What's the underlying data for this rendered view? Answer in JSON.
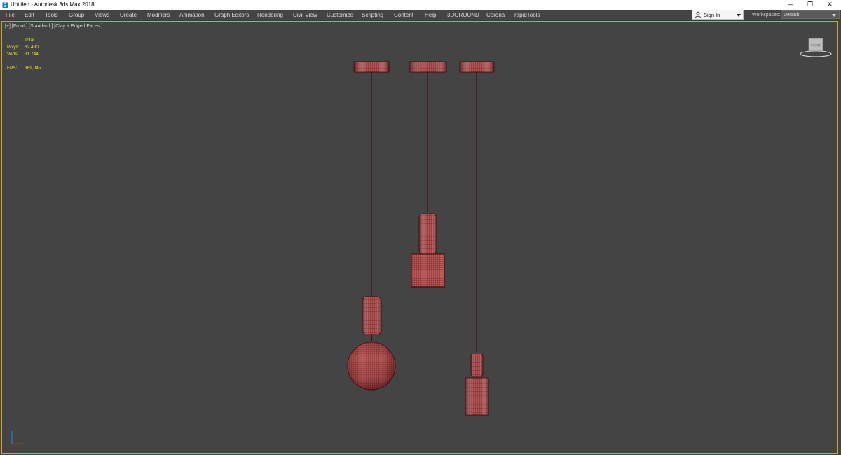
{
  "window": {
    "title": "Untitled - Autodesk 3ds Max 2018",
    "controls": {
      "minimize": "—",
      "restore": "❐",
      "close": "✕"
    }
  },
  "menu": {
    "items": [
      "File",
      "Edit",
      "Tools",
      "Group",
      "Views",
      "Create",
      "Modifiers",
      "Animation",
      "Graph Editors",
      "Rendering",
      "Civil View",
      "Customize",
      "Scripting",
      "Content",
      "Help",
      "3DGROUND",
      "Corona",
      "rapidTools"
    ]
  },
  "account": {
    "signin_label": "Sign In"
  },
  "workspaces": {
    "label": "Workspaces:",
    "value": "Default"
  },
  "viewport": {
    "label": "[+] [Front ] [Standard ] [Clay + Edged Faces ]",
    "stats": {
      "total_label": "Total",
      "polys_label": "Polys:",
      "polys_value": "62 480",
      "verts_label": "Verts:",
      "verts_value": "31 744",
      "fps_label": "FPS:",
      "fps_value": "389,045"
    },
    "viewcube_label": "FRONT"
  },
  "colors": {
    "viewport_bg": "#444444",
    "mesh_fill": "#b85a5a",
    "mesh_wire": "#5a0f12",
    "stats_text": "#e8e23a",
    "active_border": "#c9a43a"
  },
  "icons": [
    "app-icon",
    "user-icon",
    "minimize-icon",
    "restore-icon",
    "close-icon",
    "axis-tripod-icon",
    "viewcube-icon"
  ]
}
